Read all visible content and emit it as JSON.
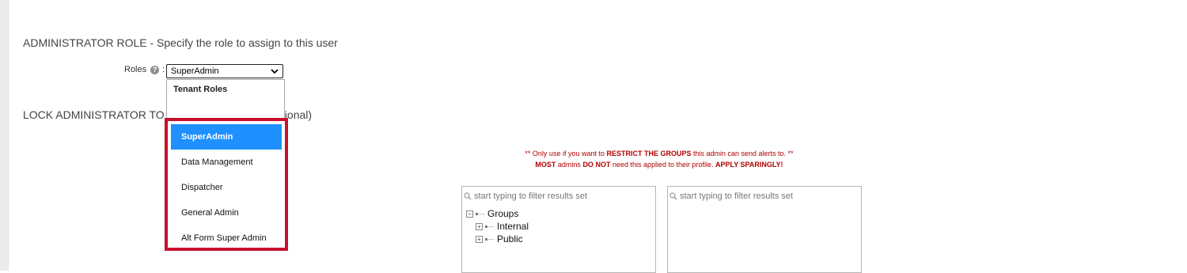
{
  "sections": {
    "admin_role_title": "ADMINISTRATOR ROLE - Specify the role to assign to this user",
    "lock_title_start": "LOCK ADMINISTRATOR TO",
    "lock_title_end": "(optional)"
  },
  "roles": {
    "label": "Roles",
    "colon": ":",
    "selected": "SuperAdmin",
    "dropdown": {
      "group_header": "Tenant Roles",
      "options": [
        {
          "label": "SuperAdmin",
          "selected": true
        },
        {
          "label": "Data Management",
          "selected": false
        },
        {
          "label": "Dispatcher",
          "selected": false
        },
        {
          "label": "General Admin",
          "selected": false
        },
        {
          "label": "Alt Form Super Admin",
          "selected": false
        }
      ]
    }
  },
  "warning": {
    "line1_a": "** Only use if you want to ",
    "line1_b": "RESTRICT THE GROUPS",
    "line1_c": " this admin can send alerts to. **",
    "line2_a": "MOST",
    "line2_b": " admins ",
    "line2_c": "DO NOT",
    "line2_d": " need this applied to their profile. ",
    "line2_e": "APPLY SPARINGLY!"
  },
  "tree_left": {
    "filter_placeholder": "start typing to filter results set",
    "root": {
      "label": "Groups",
      "expander": "⊟"
    },
    "children": [
      {
        "label": "Internal",
        "expander": "⊞"
      },
      {
        "label": "Public",
        "expander": "⊞"
      }
    ]
  },
  "tree_right": {
    "filter_placeholder": "start typing to filter results set"
  },
  "colors": {
    "highlight_border": "#c8102e",
    "selected_option": "#1e90ff",
    "warning_text": "#b00000"
  }
}
